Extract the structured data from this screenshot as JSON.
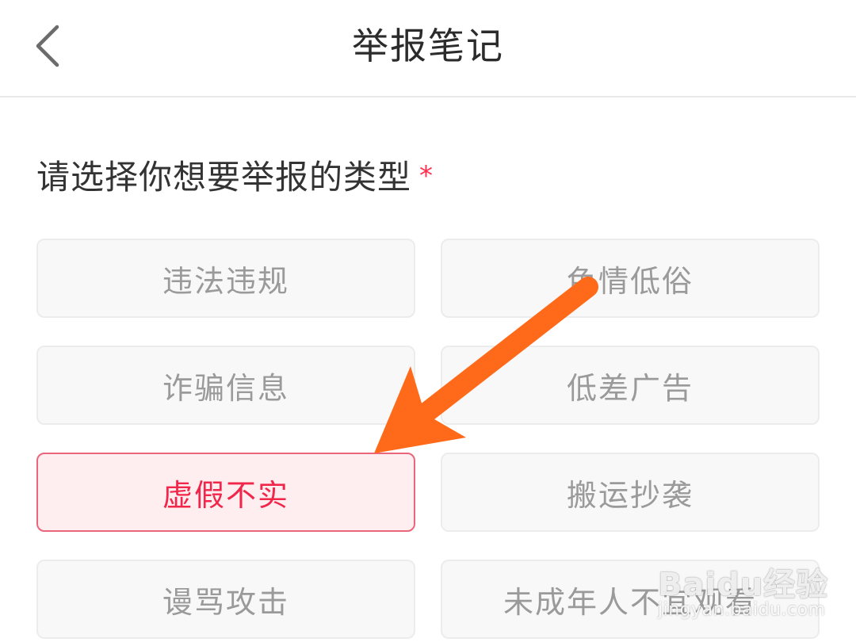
{
  "header": {
    "title": "举报笔记",
    "back_icon": "chevron-left-icon"
  },
  "form": {
    "heading": "请选择你想要举报的类型",
    "required_mark": "*",
    "options": [
      {
        "label": "违法违规",
        "selected": false
      },
      {
        "label": "色情低俗",
        "selected": false
      },
      {
        "label": "诈骗信息",
        "selected": false
      },
      {
        "label": "低差广告",
        "selected": false
      },
      {
        "label": "虚假不实",
        "selected": true
      },
      {
        "label": "搬运抄袭",
        "selected": false
      },
      {
        "label": "谩骂攻击",
        "selected": false
      },
      {
        "label": "未成年人不宜观看",
        "selected": false
      }
    ]
  },
  "watermark": {
    "logo": "Baidu经验",
    "url": "jingyan.baidu.com"
  },
  "colors": {
    "accent": "#f0264a",
    "selected_bg": "#ffeef0",
    "option_bg": "#f8f8f8",
    "option_text": "#9a9a9a",
    "arrow": "#ff6a1a"
  }
}
